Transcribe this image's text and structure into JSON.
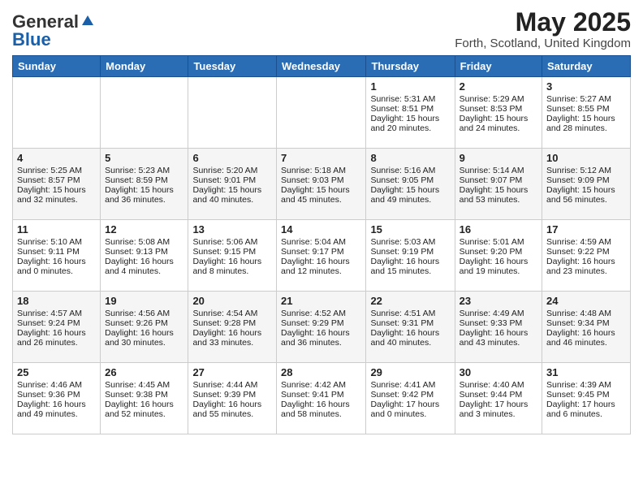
{
  "header": {
    "logo_general": "General",
    "logo_blue": "Blue",
    "month_title": "May 2025",
    "location": "Forth, Scotland, United Kingdom"
  },
  "days_of_week": [
    "Sunday",
    "Monday",
    "Tuesday",
    "Wednesday",
    "Thursday",
    "Friday",
    "Saturday"
  ],
  "weeks": [
    [
      {
        "day": "",
        "content": ""
      },
      {
        "day": "",
        "content": ""
      },
      {
        "day": "",
        "content": ""
      },
      {
        "day": "",
        "content": ""
      },
      {
        "day": "1",
        "content": "Sunrise: 5:31 AM\nSunset: 8:51 PM\nDaylight: 15 hours\nand 20 minutes."
      },
      {
        "day": "2",
        "content": "Sunrise: 5:29 AM\nSunset: 8:53 PM\nDaylight: 15 hours\nand 24 minutes."
      },
      {
        "day": "3",
        "content": "Sunrise: 5:27 AM\nSunset: 8:55 PM\nDaylight: 15 hours\nand 28 minutes."
      }
    ],
    [
      {
        "day": "4",
        "content": "Sunrise: 5:25 AM\nSunset: 8:57 PM\nDaylight: 15 hours\nand 32 minutes."
      },
      {
        "day": "5",
        "content": "Sunrise: 5:23 AM\nSunset: 8:59 PM\nDaylight: 15 hours\nand 36 minutes."
      },
      {
        "day": "6",
        "content": "Sunrise: 5:20 AM\nSunset: 9:01 PM\nDaylight: 15 hours\nand 40 minutes."
      },
      {
        "day": "7",
        "content": "Sunrise: 5:18 AM\nSunset: 9:03 PM\nDaylight: 15 hours\nand 45 minutes."
      },
      {
        "day": "8",
        "content": "Sunrise: 5:16 AM\nSunset: 9:05 PM\nDaylight: 15 hours\nand 49 minutes."
      },
      {
        "day": "9",
        "content": "Sunrise: 5:14 AM\nSunset: 9:07 PM\nDaylight: 15 hours\nand 53 minutes."
      },
      {
        "day": "10",
        "content": "Sunrise: 5:12 AM\nSunset: 9:09 PM\nDaylight: 15 hours\nand 56 minutes."
      }
    ],
    [
      {
        "day": "11",
        "content": "Sunrise: 5:10 AM\nSunset: 9:11 PM\nDaylight: 16 hours\nand 0 minutes."
      },
      {
        "day": "12",
        "content": "Sunrise: 5:08 AM\nSunset: 9:13 PM\nDaylight: 16 hours\nand 4 minutes."
      },
      {
        "day": "13",
        "content": "Sunrise: 5:06 AM\nSunset: 9:15 PM\nDaylight: 16 hours\nand 8 minutes."
      },
      {
        "day": "14",
        "content": "Sunrise: 5:04 AM\nSunset: 9:17 PM\nDaylight: 16 hours\nand 12 minutes."
      },
      {
        "day": "15",
        "content": "Sunrise: 5:03 AM\nSunset: 9:19 PM\nDaylight: 16 hours\nand 15 minutes."
      },
      {
        "day": "16",
        "content": "Sunrise: 5:01 AM\nSunset: 9:20 PM\nDaylight: 16 hours\nand 19 minutes."
      },
      {
        "day": "17",
        "content": "Sunrise: 4:59 AM\nSunset: 9:22 PM\nDaylight: 16 hours\nand 23 minutes."
      }
    ],
    [
      {
        "day": "18",
        "content": "Sunrise: 4:57 AM\nSunset: 9:24 PM\nDaylight: 16 hours\nand 26 minutes."
      },
      {
        "day": "19",
        "content": "Sunrise: 4:56 AM\nSunset: 9:26 PM\nDaylight: 16 hours\nand 30 minutes."
      },
      {
        "day": "20",
        "content": "Sunrise: 4:54 AM\nSunset: 9:28 PM\nDaylight: 16 hours\nand 33 minutes."
      },
      {
        "day": "21",
        "content": "Sunrise: 4:52 AM\nSunset: 9:29 PM\nDaylight: 16 hours\nand 36 minutes."
      },
      {
        "day": "22",
        "content": "Sunrise: 4:51 AM\nSunset: 9:31 PM\nDaylight: 16 hours\nand 40 minutes."
      },
      {
        "day": "23",
        "content": "Sunrise: 4:49 AM\nSunset: 9:33 PM\nDaylight: 16 hours\nand 43 minutes."
      },
      {
        "day": "24",
        "content": "Sunrise: 4:48 AM\nSunset: 9:34 PM\nDaylight: 16 hours\nand 46 minutes."
      }
    ],
    [
      {
        "day": "25",
        "content": "Sunrise: 4:46 AM\nSunset: 9:36 PM\nDaylight: 16 hours\nand 49 minutes."
      },
      {
        "day": "26",
        "content": "Sunrise: 4:45 AM\nSunset: 9:38 PM\nDaylight: 16 hours\nand 52 minutes."
      },
      {
        "day": "27",
        "content": "Sunrise: 4:44 AM\nSunset: 9:39 PM\nDaylight: 16 hours\nand 55 minutes."
      },
      {
        "day": "28",
        "content": "Sunrise: 4:42 AM\nSunset: 9:41 PM\nDaylight: 16 hours\nand 58 minutes."
      },
      {
        "day": "29",
        "content": "Sunrise: 4:41 AM\nSunset: 9:42 PM\nDaylight: 17 hours\nand 0 minutes."
      },
      {
        "day": "30",
        "content": "Sunrise: 4:40 AM\nSunset: 9:44 PM\nDaylight: 17 hours\nand 3 minutes."
      },
      {
        "day": "31",
        "content": "Sunrise: 4:39 AM\nSunset: 9:45 PM\nDaylight: 17 hours\nand 6 minutes."
      }
    ]
  ]
}
